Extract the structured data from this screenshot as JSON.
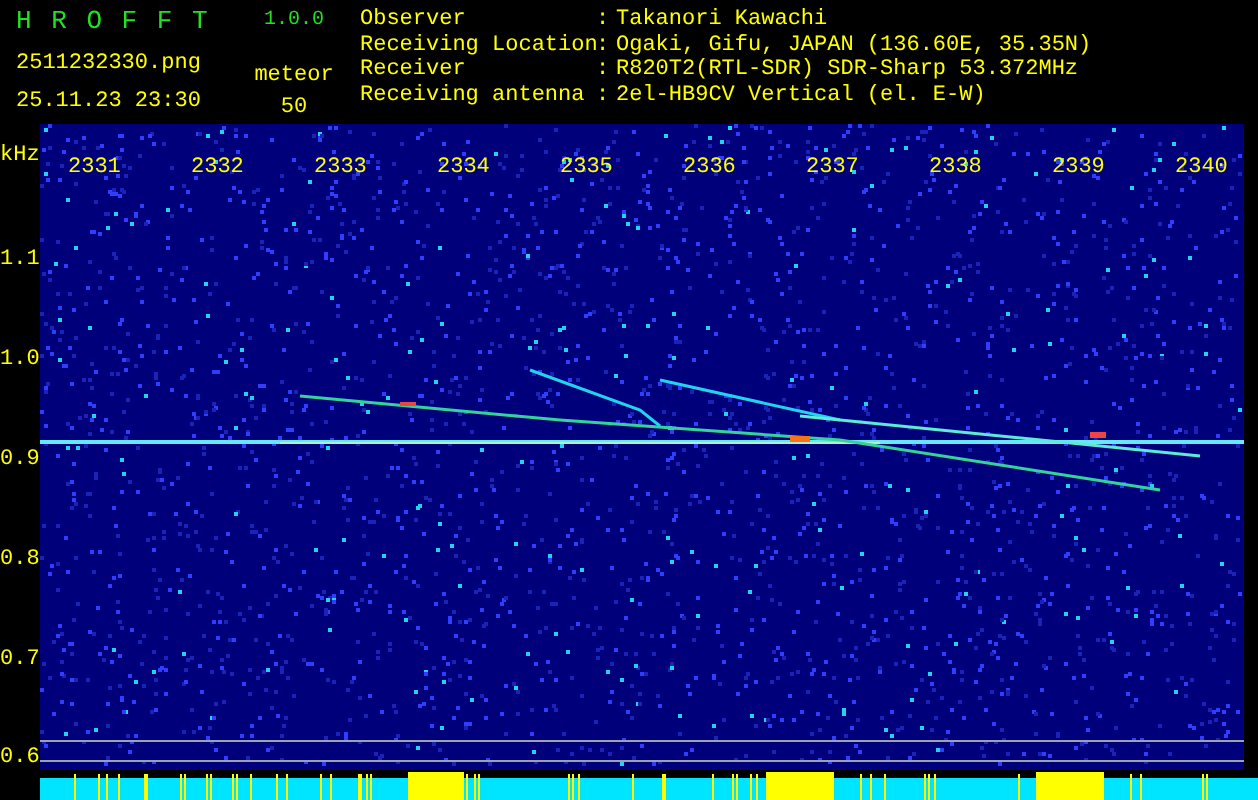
{
  "header": {
    "app_title": "H R O F F T",
    "version": "1.0.0",
    "file_name": "2511232330.png",
    "date_time": "25.11.23 23:30",
    "count_label": "meteor",
    "count": "50"
  },
  "info": [
    {
      "label": "Observer",
      "separator": ":",
      "value": "Takanori Kawachi"
    },
    {
      "label": "Receiving Location",
      "separator": ":",
      "value": "Ogaki, Gifu, JAPAN (136.60E, 35.35N)"
    },
    {
      "label": "Receiver",
      "separator": ":",
      "value": "R820T2(RTL-SDR) SDR-Sharp 53.372MHz"
    },
    {
      "label": "Receiving antenna",
      "separator": ":",
      "value": "2el-HB9CV Vertical (el. E-W)"
    }
  ],
  "y_axis": {
    "unit": "kHz",
    "ticks": [
      "1.1",
      "1.0",
      "0.9",
      "0.8",
      "0.7",
      "0.6"
    ]
  },
  "time_labels": [
    "2331",
    "2332",
    "2333",
    "2334",
    "2335",
    "2336",
    "2337",
    "2338",
    "2339",
    "2340"
  ]
}
